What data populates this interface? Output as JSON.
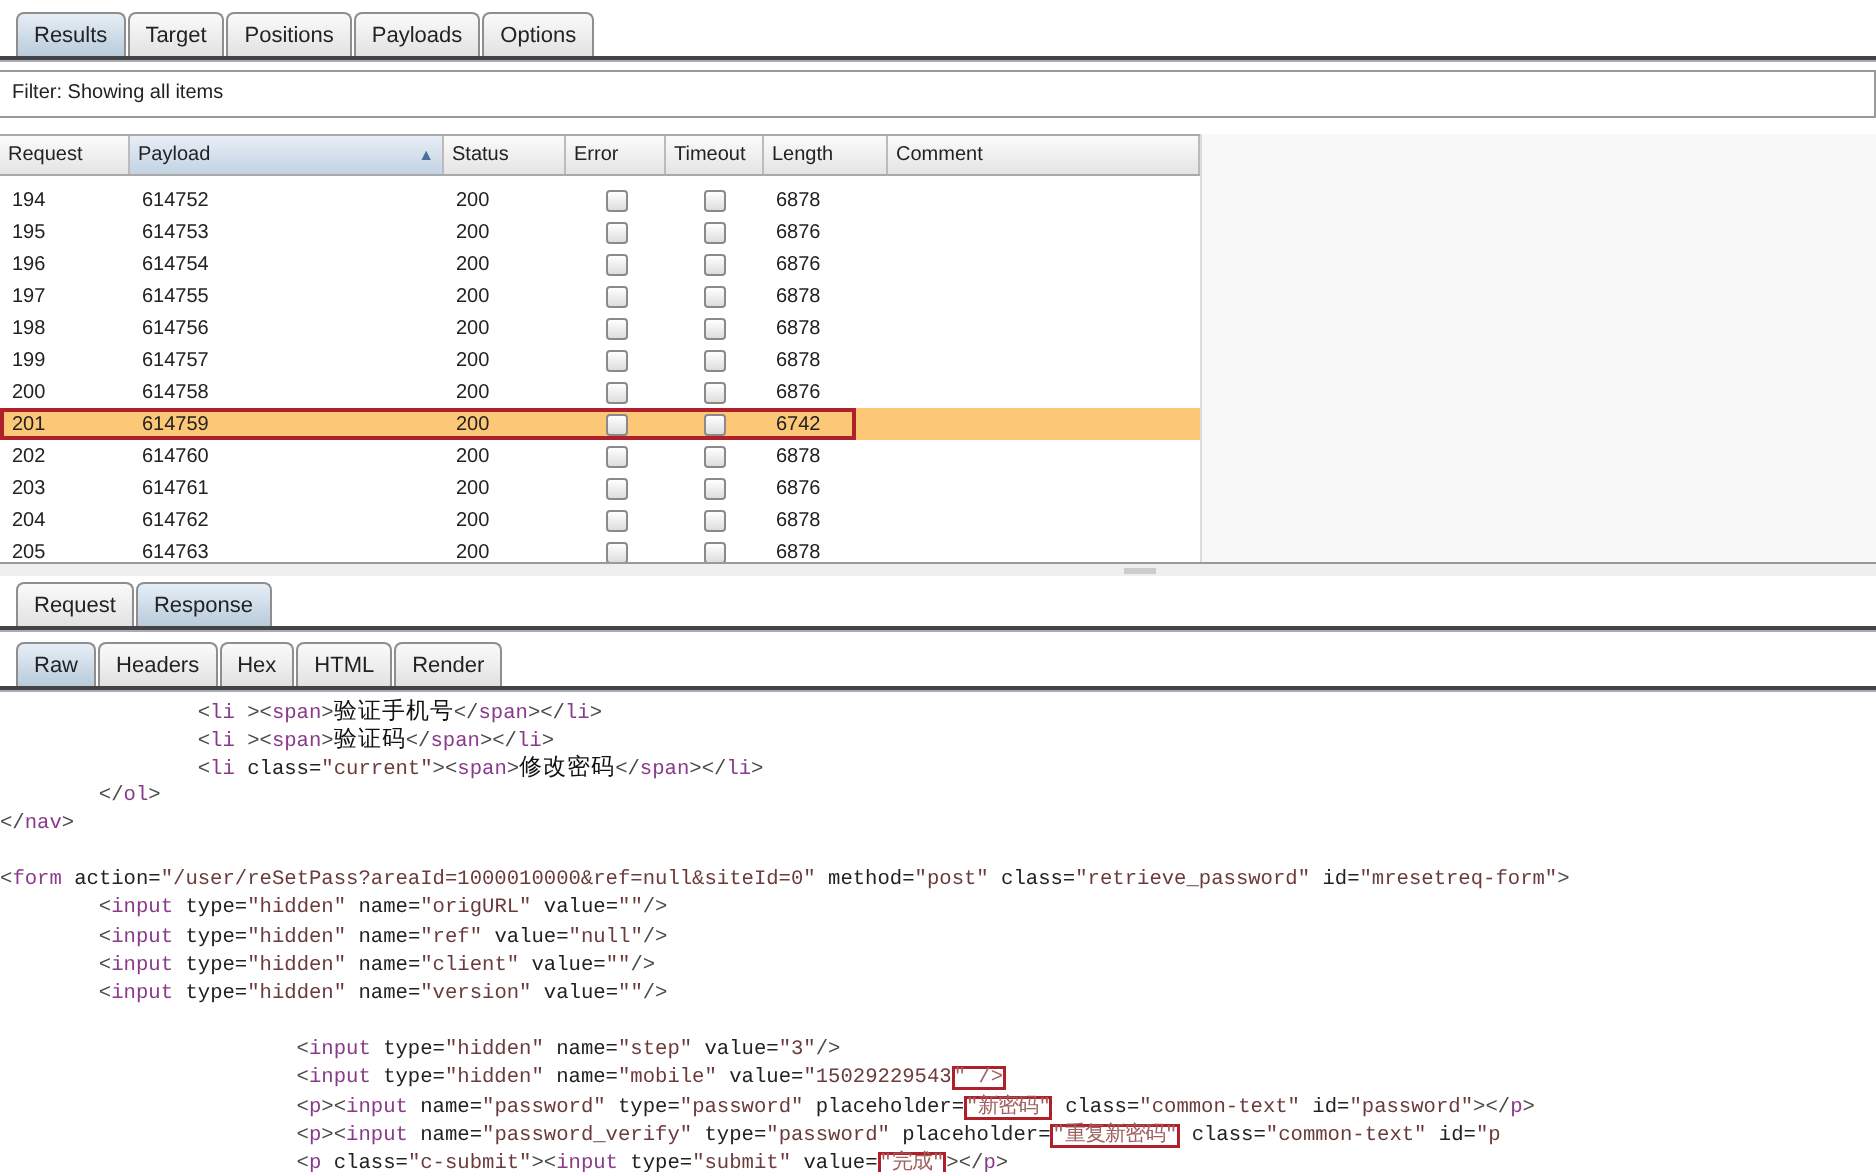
{
  "tabs": [
    {
      "label": "Results",
      "selected": true
    },
    {
      "label": "Target",
      "selected": false
    },
    {
      "label": "Positions",
      "selected": false
    },
    {
      "label": "Payloads",
      "selected": false
    },
    {
      "label": "Options",
      "selected": false
    }
  ],
  "filter": "Filter:  Showing all items",
  "results_table": {
    "columns": [
      {
        "label": "Request"
      },
      {
        "label": "Payload",
        "sort_indicator": "▲"
      },
      {
        "label": "Status"
      },
      {
        "label": "Error"
      },
      {
        "label": "Timeout"
      },
      {
        "label": "Length"
      },
      {
        "label": "Comment"
      }
    ],
    "rows": [
      {
        "request": "194",
        "payload": "614752",
        "status": "200",
        "error": false,
        "timeout": false,
        "length": "6878",
        "selected": false,
        "annotated": false
      },
      {
        "request": "195",
        "payload": "614753",
        "status": "200",
        "error": false,
        "timeout": false,
        "length": "6876",
        "selected": false,
        "annotated": false
      },
      {
        "request": "196",
        "payload": "614754",
        "status": "200",
        "error": false,
        "timeout": false,
        "length": "6876",
        "selected": false,
        "annotated": false
      },
      {
        "request": "197",
        "payload": "614755",
        "status": "200",
        "error": false,
        "timeout": false,
        "length": "6878",
        "selected": false,
        "annotated": false
      },
      {
        "request": "198",
        "payload": "614756",
        "status": "200",
        "error": false,
        "timeout": false,
        "length": "6878",
        "selected": false,
        "annotated": false
      },
      {
        "request": "199",
        "payload": "614757",
        "status": "200",
        "error": false,
        "timeout": false,
        "length": "6878",
        "selected": false,
        "annotated": false
      },
      {
        "request": "200",
        "payload": "614758",
        "status": "200",
        "error": false,
        "timeout": false,
        "length": "6876",
        "selected": false,
        "annotated": false
      },
      {
        "request": "201",
        "payload": "614759",
        "status": "200",
        "error": false,
        "timeout": false,
        "length": "6742",
        "selected": true,
        "annotated": true
      },
      {
        "request": "202",
        "payload": "614760",
        "status": "200",
        "error": false,
        "timeout": false,
        "length": "6878",
        "selected": false,
        "annotated": false
      },
      {
        "request": "203",
        "payload": "614761",
        "status": "200",
        "error": false,
        "timeout": false,
        "length": "6876",
        "selected": false,
        "annotated": false
      },
      {
        "request": "204",
        "payload": "614762",
        "status": "200",
        "error": false,
        "timeout": false,
        "length": "6878",
        "selected": false,
        "annotated": false
      },
      {
        "request": "205",
        "payload": "614763",
        "status": "200",
        "error": false,
        "timeout": false,
        "length": "6878",
        "selected": false,
        "annotated": false
      }
    ]
  },
  "message_tabs": [
    {
      "label": "Request",
      "selected": false
    },
    {
      "label": "Response",
      "selected": true
    }
  ],
  "view_tabs": [
    {
      "label": "Raw",
      "selected": true
    },
    {
      "label": "Headers",
      "selected": false
    },
    {
      "label": "Hex",
      "selected": false
    },
    {
      "label": "HTML",
      "selected": false
    },
    {
      "label": "Render",
      "selected": false
    }
  ],
  "response_lines": [
    {
      "kind": "code",
      "tokens": [
        {
          "kind": "p",
          "text": "                <"
        },
        {
          "kind": "tag",
          "text": "li"
        },
        {
          "kind": "p",
          "text": " ><"
        },
        {
          "kind": "tag",
          "text": "span"
        },
        {
          "kind": "p",
          "text": ">"
        },
        {
          "kind": "text",
          "text": "验证手机号"
        },
        {
          "kind": "p",
          "text": "</"
        },
        {
          "kind": "tag",
          "text": "span"
        },
        {
          "kind": "p",
          "text": "></"
        },
        {
          "kind": "tag",
          "text": "li"
        },
        {
          "kind": "p",
          "text": ">"
        }
      ]
    },
    {
      "kind": "code",
      "tokens": [
        {
          "kind": "p",
          "text": "                <"
        },
        {
          "kind": "tag",
          "text": "li"
        },
        {
          "kind": "p",
          "text": " ><"
        },
        {
          "kind": "tag",
          "text": "span"
        },
        {
          "kind": "p",
          "text": ">"
        },
        {
          "kind": "text",
          "text": "验证码"
        },
        {
          "kind": "p",
          "text": "</"
        },
        {
          "kind": "tag",
          "text": "span"
        },
        {
          "kind": "p",
          "text": "></"
        },
        {
          "kind": "tag",
          "text": "li"
        },
        {
          "kind": "p",
          "text": ">"
        }
      ]
    },
    {
      "kind": "code",
      "tokens": [
        {
          "kind": "p",
          "text": "                <"
        },
        {
          "kind": "tag",
          "text": "li"
        },
        {
          "kind": "attr",
          "text": " class="
        },
        {
          "kind": "val",
          "text": "\"current\""
        },
        {
          "kind": "p",
          "text": "><"
        },
        {
          "kind": "tag",
          "text": "span"
        },
        {
          "kind": "p",
          "text": ">"
        },
        {
          "kind": "text",
          "text": "修改密码"
        },
        {
          "kind": "p",
          "text": "</"
        },
        {
          "kind": "tag",
          "text": "span"
        },
        {
          "kind": "p",
          "text": "></"
        },
        {
          "kind": "tag",
          "text": "li"
        },
        {
          "kind": "p",
          "text": ">"
        }
      ]
    },
    {
      "kind": "code",
      "tokens": [
        {
          "kind": "p",
          "text": "        </"
        },
        {
          "kind": "tag",
          "text": "ol"
        },
        {
          "kind": "p",
          "text": ">"
        }
      ]
    },
    {
      "kind": "code",
      "tokens": [
        {
          "kind": "p",
          "text": "</"
        },
        {
          "kind": "tag",
          "text": "nav"
        },
        {
          "kind": "p",
          "text": ">"
        }
      ]
    },
    {
      "kind": "blank"
    },
    {
      "kind": "code",
      "tokens": [
        {
          "kind": "p",
          "text": "<"
        },
        {
          "kind": "tag",
          "text": "form"
        },
        {
          "kind": "attr",
          "text": " action="
        },
        {
          "kind": "val",
          "text": "\"/user/reSetPass?areaId=1000010000&ref=null&siteId=0\""
        },
        {
          "kind": "attr",
          "text": " method="
        },
        {
          "kind": "val",
          "text": "\"post\""
        },
        {
          "kind": "attr",
          "text": " class="
        },
        {
          "kind": "val",
          "text": "\"retrieve_password\""
        },
        {
          "kind": "attr",
          "text": " id="
        },
        {
          "kind": "val",
          "text": "\"mresetreq-form\""
        },
        {
          "kind": "p",
          "text": ">"
        }
      ]
    },
    {
      "kind": "code",
      "tokens": [
        {
          "kind": "p",
          "text": "        <"
        },
        {
          "kind": "tag",
          "text": "input"
        },
        {
          "kind": "attr",
          "text": " type="
        },
        {
          "kind": "val",
          "text": "\"hidden\""
        },
        {
          "kind": "attr",
          "text": " name="
        },
        {
          "kind": "val",
          "text": "\"origURL\""
        },
        {
          "kind": "attr",
          "text": " value="
        },
        {
          "kind": "val",
          "text": "\"\""
        },
        {
          "kind": "p",
          "text": "/>"
        }
      ]
    },
    {
      "kind": "code",
      "tokens": [
        {
          "kind": "p",
          "text": "        <"
        },
        {
          "kind": "tag",
          "text": "input"
        },
        {
          "kind": "attr",
          "text": " type="
        },
        {
          "kind": "val",
          "text": "\"hidden\""
        },
        {
          "kind": "attr",
          "text": " name="
        },
        {
          "kind": "val",
          "text": "\"ref\""
        },
        {
          "kind": "attr",
          "text": " value="
        },
        {
          "kind": "val",
          "text": "\"null\""
        },
        {
          "kind": "p",
          "text": "/>"
        }
      ]
    },
    {
      "kind": "code",
      "tokens": [
        {
          "kind": "p",
          "text": "        <"
        },
        {
          "kind": "tag",
          "text": "input"
        },
        {
          "kind": "attr",
          "text": " type="
        },
        {
          "kind": "val",
          "text": "\"hidden\""
        },
        {
          "kind": "attr",
          "text": " name="
        },
        {
          "kind": "val",
          "text": "\"client\""
        },
        {
          "kind": "attr",
          "text": " value="
        },
        {
          "kind": "val",
          "text": "\"\""
        },
        {
          "kind": "p",
          "text": "/>"
        }
      ]
    },
    {
      "kind": "code",
      "tokens": [
        {
          "kind": "p",
          "text": "        <"
        },
        {
          "kind": "tag",
          "text": "input"
        },
        {
          "kind": "attr",
          "text": " type="
        },
        {
          "kind": "val",
          "text": "\"hidden\""
        },
        {
          "kind": "attr",
          "text": " name="
        },
        {
          "kind": "val",
          "text": "\"version\""
        },
        {
          "kind": "attr",
          "text": " value="
        },
        {
          "kind": "val",
          "text": "\"\""
        },
        {
          "kind": "p",
          "text": "/>"
        }
      ]
    },
    {
      "kind": "blank"
    },
    {
      "kind": "code",
      "tokens": [
        {
          "kind": "p",
          "text": "                        <"
        },
        {
          "kind": "tag",
          "text": "input"
        },
        {
          "kind": "attr",
          "text": " type="
        },
        {
          "kind": "val",
          "text": "\"hidden\""
        },
        {
          "kind": "attr",
          "text": " name="
        },
        {
          "kind": "val",
          "text": "\"step\""
        },
        {
          "kind": "attr",
          "text": " value="
        },
        {
          "kind": "val",
          "text": "\"3\""
        },
        {
          "kind": "p",
          "text": "/>"
        }
      ]
    },
    {
      "kind": "code",
      "tokens": [
        {
          "kind": "p",
          "text": "                        <"
        },
        {
          "kind": "tag",
          "text": "input"
        },
        {
          "kind": "attr",
          "text": " type="
        },
        {
          "kind": "val",
          "text": "\"hidden\""
        },
        {
          "kind": "attr",
          "text": " name="
        },
        {
          "kind": "val",
          "text": "\"mobile\""
        },
        {
          "kind": "attr",
          "text": " value="
        },
        {
          "kind": "val",
          "text": "\"15029229543"
        },
        {
          "kind": "box",
          "text": "\" />"
        }
      ]
    },
    {
      "kind": "code",
      "tokens": [
        {
          "kind": "p",
          "text": "                        <"
        },
        {
          "kind": "tag",
          "text": "p"
        },
        {
          "kind": "p",
          "text": "><"
        },
        {
          "kind": "tag",
          "text": "input"
        },
        {
          "kind": "attr",
          "text": " name="
        },
        {
          "kind": "val",
          "text": "\"password\""
        },
        {
          "kind": "attr",
          "text": " type="
        },
        {
          "kind": "val",
          "text": "\"password\""
        },
        {
          "kind": "attr",
          "text": " placeholder="
        },
        {
          "kind": "box",
          "text": "\"新密码\""
        },
        {
          "kind": "attr",
          "text": " class="
        },
        {
          "kind": "val",
          "text": "\"common-text\""
        },
        {
          "kind": "attr",
          "text": " id="
        },
        {
          "kind": "val",
          "text": "\"password\""
        },
        {
          "kind": "p",
          "text": "></"
        },
        {
          "kind": "tag",
          "text": "p"
        },
        {
          "kind": "p",
          "text": ">"
        }
      ]
    },
    {
      "kind": "code",
      "tokens": [
        {
          "kind": "p",
          "text": "                        <"
        },
        {
          "kind": "tag",
          "text": "p"
        },
        {
          "kind": "p",
          "text": "><"
        },
        {
          "kind": "tag",
          "text": "input"
        },
        {
          "kind": "attr",
          "text": " name="
        },
        {
          "kind": "val",
          "text": "\"password_verify\""
        },
        {
          "kind": "attr",
          "text": " type="
        },
        {
          "kind": "val",
          "text": "\"password\""
        },
        {
          "kind": "attr",
          "text": " placeholder="
        },
        {
          "kind": "box",
          "text": "\"重复新密码\""
        },
        {
          "kind": "attr",
          "text": " class="
        },
        {
          "kind": "val",
          "text": "\"common-text\""
        },
        {
          "kind": "attr",
          "text": " id="
        },
        {
          "kind": "val",
          "text": "\"p"
        }
      ]
    },
    {
      "kind": "code",
      "tokens": [
        {
          "kind": "p",
          "text": "                        <"
        },
        {
          "kind": "tag",
          "text": "p"
        },
        {
          "kind": "attr",
          "text": " class="
        },
        {
          "kind": "val",
          "text": "\"c-submit\""
        },
        {
          "kind": "p",
          "text": "><"
        },
        {
          "kind": "tag",
          "text": "input"
        },
        {
          "kind": "attr",
          "text": " type="
        },
        {
          "kind": "val",
          "text": "\"submit\""
        },
        {
          "kind": "attr",
          "text": " value="
        },
        {
          "kind": "box",
          "text": "\"完成\""
        },
        {
          "kind": "p",
          "text": "></"
        },
        {
          "kind": "tag",
          "text": "p"
        },
        {
          "kind": "p",
          "text": ">"
        }
      ]
    }
  ]
}
